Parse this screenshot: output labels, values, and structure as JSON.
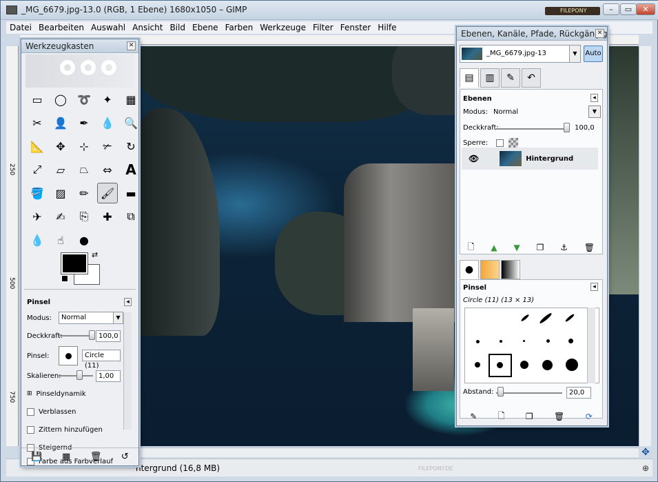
{
  "window": {
    "title": "_MG_6679.jpg-13.0 (RGB, 1 Ebene) 1680x1050 – GIMP",
    "badge": "FILEPONY"
  },
  "menu": [
    "Datei",
    "Bearbeiten",
    "Auswahl",
    "Ansicht",
    "Bild",
    "Ebene",
    "Farben",
    "Werkzeuge",
    "Filter",
    "Fenster",
    "Hilfe"
  ],
  "ruler": {
    "left_ticks": [
      "250",
      "500",
      "750"
    ]
  },
  "status": {
    "text": "ntergrund (16,8 MB)",
    "watermark": "FILEPONY.DE"
  },
  "toolbox": {
    "title": "Werkzeugkasten",
    "tool_icons": [
      "rect-select-icon",
      "ellipse-select-icon",
      "free-select-icon",
      "fuzzy-select-icon",
      "by-color-select-icon",
      "scissors-icon",
      "foreground-select-icon",
      "paths-icon",
      "color-picker-icon",
      "zoom-icon",
      "measure-icon",
      "move-icon",
      "align-icon",
      "crop-icon",
      "rotate-icon",
      "scale-icon",
      "shear-icon",
      "perspective-icon",
      "flip-icon",
      "text-icon",
      "bucket-fill-icon",
      "blend-icon",
      "pencil-icon",
      "paintbrush-icon",
      "eraser-icon",
      "airbrush-icon",
      "ink-icon",
      "clone-icon",
      "heal-icon",
      "perspective-clone-icon",
      "blur-icon",
      "smudge-icon",
      "dodge-burn-icon"
    ],
    "selected_tool": 23,
    "foreground_color": "#000000",
    "background_color": "#ffffff",
    "options": {
      "header": "Pinsel",
      "mode_label": "Modus:",
      "mode_value": "Normal",
      "opacity_label": "Deckkraft:",
      "opacity_value": "100,0",
      "brush_label": "Pinsel:",
      "brush_value": "Circle (11)",
      "scale_label": "Skalieren:",
      "scale_value": "1,00",
      "dynamics_label": "Pinseldynamik",
      "fade_label": "Verblassen",
      "jitter_label": "Zittern hinzufügen",
      "incremental_label": "Steigernd",
      "gradient_label": "Farbe aus Farbverlauf"
    }
  },
  "layers": {
    "title": "Ebenen, Kanäle, Pfade, Rückgängig...",
    "image_name": "_MG_6679.jpg-13",
    "auto_label": "Auto",
    "section_header": "Ebenen",
    "mode_label": "Modus:",
    "mode_value": "Normal",
    "opacity_label": "Deckkraft:",
    "opacity_value": "100,0",
    "lock_label": "Sperre:",
    "layer_name": "Hintergrund",
    "brushes_header": "Pinsel",
    "brush_name": "Circle (11) (13 × 13)",
    "spacing_label": "Abstand:",
    "spacing_value": "20,0"
  }
}
